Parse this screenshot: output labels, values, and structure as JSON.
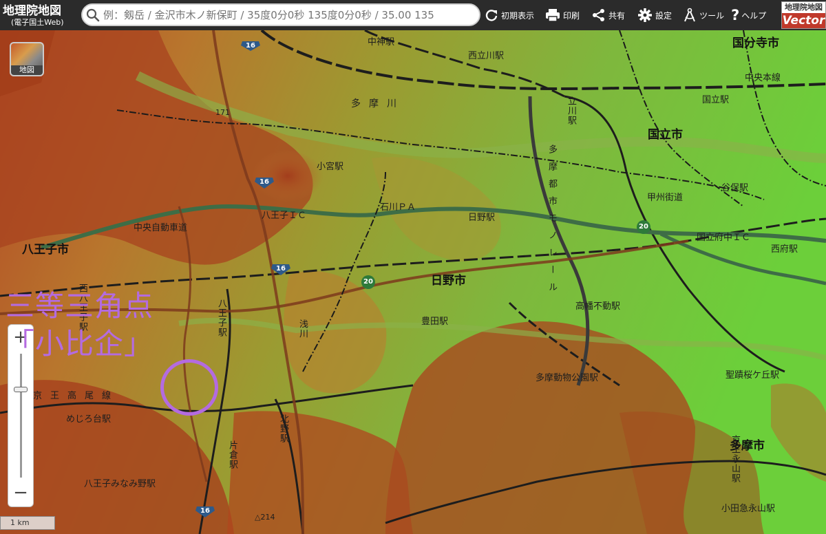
{
  "app": {
    "title": "地理院地図",
    "subtitle": "(電子国土Web)"
  },
  "search": {
    "placeholder": "例：剱岳 / 金沢市木ノ新保町 / 35度0分0秒 135度0分0秒 / 35.00 135"
  },
  "toolbar": {
    "initial_view": "初期表示",
    "print": "印刷",
    "share": "共有",
    "settings": "設定",
    "tools": "ツール",
    "help": "ヘルプ"
  },
  "vector_logo": {
    "line1": "地理院地図",
    "line2": "Vector"
  },
  "layer_button": {
    "label": "地図"
  },
  "zoom": {
    "in": "+",
    "out": "−"
  },
  "scale_bar": {
    "label": "1 km"
  },
  "annotation": {
    "line1": "三等三角点",
    "line2": "「小比企」"
  },
  "map": {
    "cities": {
      "kokubunji": "国分寺市",
      "kunitachi": "国立市",
      "hachioji": "八王子市",
      "hino": "日野市",
      "tama": "多摩市"
    },
    "rivers": {
      "tamagawa": "多摩川",
      "asakawa": "浅川"
    },
    "stations": {
      "nakagami": "中神駅",
      "nishitachikawa": "西立川駅",
      "kunitachi": "国立駅",
      "komiya": "小宮駅",
      "yaho": "谷保駅",
      "hino": "日野駅",
      "nishifu": "西府駅",
      "takahatafudo": "高幡不動駅",
      "toyoda": "豊田駅",
      "seisekisakuragaoka": "聖蹟桜ケ丘駅",
      "tamadobutsukoen": "多摩動物公園駅",
      "mejirodai": "めじろ台駅",
      "minaminohachioji": "八王子みなみ野駅",
      "odakyunagayama": "小田急永山駅",
      "tachikawa": "立川駅",
      "hachioji": "八王子駅",
      "nishihachioji": "西八王子駅",
      "kitano": "北野駅",
      "katakura": "片倉駅",
      "keionagayama": "京王永山駅"
    },
    "roads": {
      "chuo_line": "中央本線",
      "koshu_kaido": "甲州街道",
      "chuo_expressway": "中央自動車道",
      "hachioji_ic": "八王子ＩＣ",
      "kunitachifuchu_ic": "国立府中ＩＣ",
      "ishikawa_pa": "石川ＰＡ",
      "keio_takao_line": "京王高尾線",
      "tama_monorail": "多摩都市モノレール",
      "route_16": "16",
      "route_20": "20",
      "route_171": "171",
      "spot_214": "△214"
    }
  }
}
